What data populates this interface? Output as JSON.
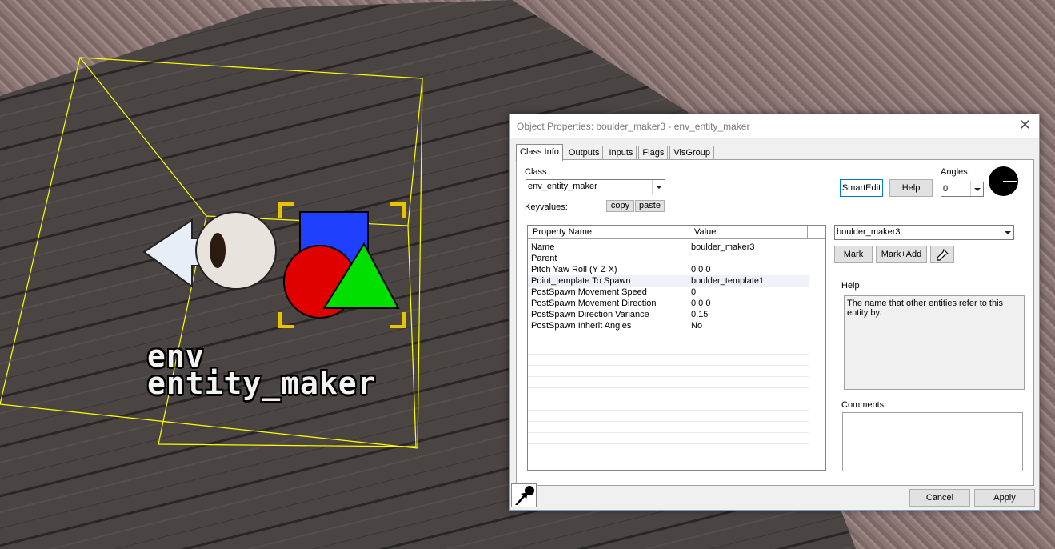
{
  "viewport": {
    "entity_label_line1": "env",
    "entity_label_line2": "entity_maker"
  },
  "dialog": {
    "title": "Object Properties: boulder_maker3 - env_entity_maker",
    "close_glyph": "✕",
    "tabs": [
      {
        "label": "Class Info",
        "active": true
      },
      {
        "label": "Outputs",
        "active": false
      },
      {
        "label": "Inputs",
        "active": false
      },
      {
        "label": "Flags",
        "active": false
      },
      {
        "label": "VisGroup",
        "active": false
      }
    ],
    "class_label": "Class:",
    "class_value": "env_entity_maker",
    "keyvalues_label": "Keyvalues:",
    "copy_label": "copy",
    "paste_label": "paste",
    "smartedit_label": "SmartEdit",
    "help_button_label": "Help",
    "angles_label": "Angles:",
    "angles_value": "0",
    "grid_headers": [
      "Property Name",
      "Value"
    ],
    "properties": [
      {
        "name": "Name",
        "value": "boulder_maker3"
      },
      {
        "name": "Parent",
        "value": ""
      },
      {
        "name": "Pitch Yaw Roll (Y Z X)",
        "value": "0 0 0"
      },
      {
        "name": "Point_template To Spawn",
        "value": "boulder_template1"
      },
      {
        "name": "PostSpawn Movement Speed",
        "value": "0"
      },
      {
        "name": "PostSpawn Movement Direction",
        "value": "0 0 0"
      },
      {
        "name": "PostSpawn Direction Variance",
        "value": "0.15"
      },
      {
        "name": "PostSpawn Inherit Angles",
        "value": "No"
      }
    ],
    "value_combo": "boulder_maker3",
    "mark_label": "Mark",
    "markadd_label": "Mark+Add",
    "help_section_label": "Help",
    "help_text": "The name that other entities refer to this entity by.",
    "comments_label": "Comments",
    "comments_value": "",
    "cancel_label": "Cancel",
    "apply_label": "Apply"
  }
}
